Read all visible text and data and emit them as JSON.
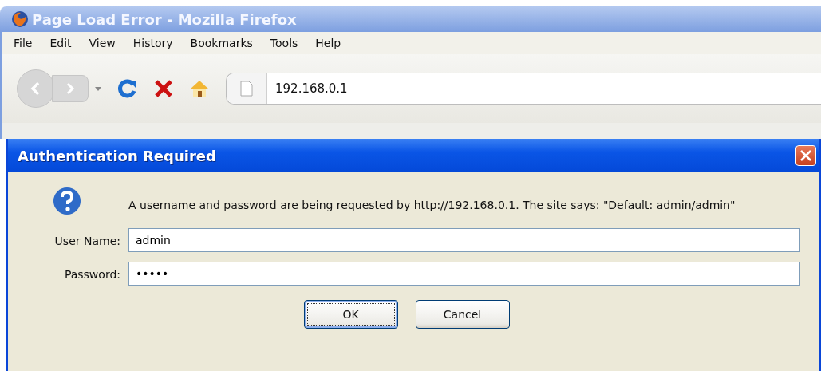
{
  "window": {
    "title": "Page Load Error - Mozilla Firefox"
  },
  "menu": [
    "File",
    "Edit",
    "View",
    "History",
    "Bookmarks",
    "Tools",
    "Help"
  ],
  "address_bar": {
    "value": "192.168.0.1"
  },
  "dialog": {
    "title": "Authentication Required",
    "message": "A username and password are being requested by http://192.168.0.1. The site says: \"Default: admin/admin\"",
    "fields": [
      {
        "label": "User Name:",
        "value": "admin"
      },
      {
        "label": "Password:",
        "value": "•••••"
      }
    ],
    "buttons": [
      {
        "label": "OK",
        "selected": true
      },
      {
        "label": "Cancel",
        "selected": false
      }
    ]
  }
}
